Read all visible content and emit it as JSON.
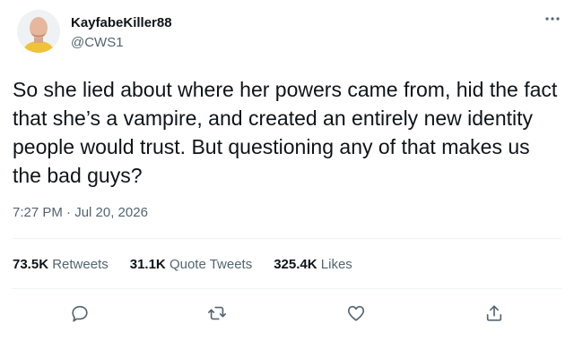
{
  "author": {
    "display_name": "KayfabeKiller88",
    "handle": "@CWS1",
    "avatar": "avatar-photo"
  },
  "more_icon": "more-horizontal-icon",
  "tweet": {
    "text": "So she lied about where her powers came from, hid the fact that she’s a vampire, and created an entirely new identity people would trust. But questioning any of that makes us the bad guys?",
    "timestamp": "7:27 PM · Jul 20, 2026"
  },
  "stats": {
    "retweets_count": "73.5K",
    "retweets_label": "Retweets",
    "quote_count": "31.1K",
    "quote_label": "Quote Tweets",
    "likes_count": "325.4K",
    "likes_label": "Likes"
  },
  "actions": [
    "reply-icon",
    "retweet-icon",
    "like-icon",
    "share-icon"
  ],
  "colors": {
    "text": "#0f1419",
    "secondary": "#536471",
    "divider": "#eff3f4"
  }
}
